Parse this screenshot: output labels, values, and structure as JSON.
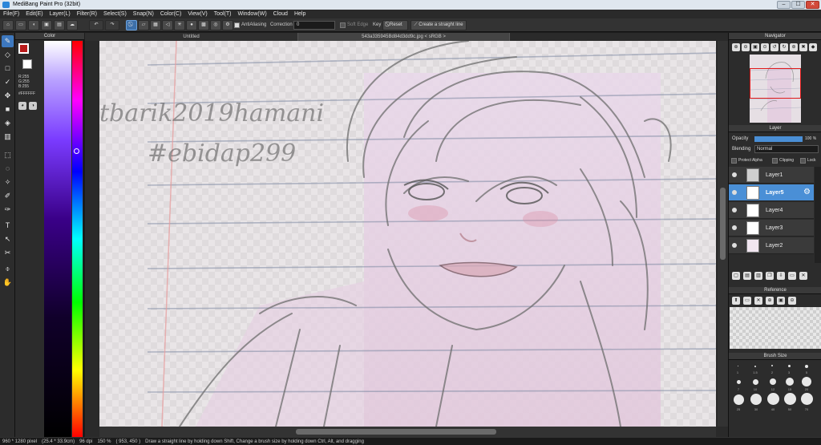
{
  "window": {
    "title": "MediBang Paint Pro (32bit)",
    "minimize": "–",
    "maximize": "☐",
    "close": "✕"
  },
  "menu": [
    "File(F)",
    "Edit(E)",
    "Layer(L)",
    "Filter(R)",
    "Select(S)",
    "Snap(N)",
    "Color(C)",
    "View(V)",
    "Tool(T)",
    "Window(W)",
    "Cloud",
    "Help"
  ],
  "toolbar": {
    "antialiasing_label": "AntiAliasing",
    "correction_label": "Correction",
    "correction_value": "0",
    "soft_edge_label": "Soft Edge",
    "key_label": "Key",
    "reset_label": "Reset",
    "straight_line_label": "Create a straight line"
  },
  "color_panel": {
    "title": "Color",
    "r": "R:255",
    "g": "G:255",
    "b": "B:255",
    "hex": "#FFFFFF",
    "fg": "#b81a1a",
    "bg": "#ffffff"
  },
  "tabs": {
    "untitled": "Untitled",
    "image": "543a335945Bd84d3dd9c.jpg < sRGB >"
  },
  "canvas_text": {
    "line1": "tbarik2019hamani",
    "line2": "#ebidap299"
  },
  "navigator": {
    "title": "Navigator"
  },
  "layer_panel": {
    "title": "Layer",
    "opacity_label": "Opacity",
    "opacity_value": "100 %",
    "opacity_level": 1.0,
    "blending_label": "Blending",
    "blending_value": "Normal",
    "protect_alpha": "Protect Alpha",
    "clipping": "Clipping",
    "lock": "Lock",
    "layers": [
      {
        "name": "Layer1",
        "selected": false
      },
      {
        "name": "Layer5",
        "selected": true
      },
      {
        "name": "Layer4",
        "selected": false
      },
      {
        "name": "Layer3",
        "selected": false
      },
      {
        "name": "Layer2",
        "selected": false
      }
    ]
  },
  "reference_panel": {
    "title": "Reference"
  },
  "brush_size_panel": {
    "title": "Brush Size",
    "sizes": [
      "1",
      "1.5",
      "2",
      "3",
      "5",
      "7",
      "10",
      "12",
      "15",
      "20",
      "25",
      "30",
      "40",
      "50",
      "70"
    ]
  },
  "status": {
    "pixels": "960 * 1280 pixel",
    "cm": "(25.4 * 33.9cm)",
    "dpi": "96 dpi",
    "zoom": "150 %",
    "coords": "( 953, 450 )",
    "hint": "Draw a straight line by holding down Shift, Change a brush size by holding down Ctrl, Alt, and dragging"
  },
  "colors": {
    "accent": "#4a8fd6",
    "panel": "#2c2c2c",
    "nav_rect": "#e01b1b"
  }
}
